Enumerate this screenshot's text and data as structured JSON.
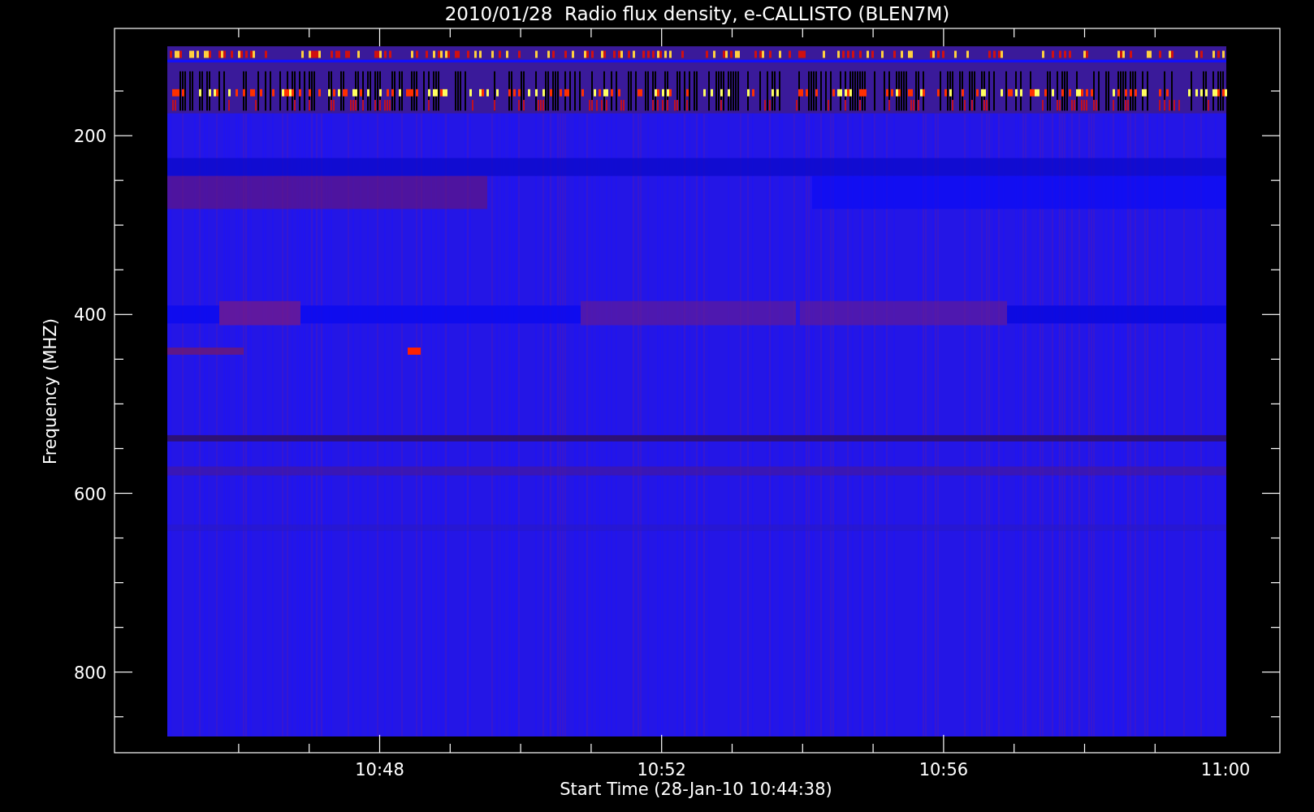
{
  "title": "2010/01/28  Radio flux density, e-CALLISTO (BLEN7M)",
  "y_axis": {
    "label": "Frequency (MHZ)",
    "ticks": [
      "200",
      "400",
      "600",
      "800"
    ]
  },
  "x_axis": {
    "label": "Start Time (28-Jan-10 10:44:38)",
    "ticks": [
      "10:48",
      "10:52",
      "10:56",
      "11:00"
    ]
  }
}
